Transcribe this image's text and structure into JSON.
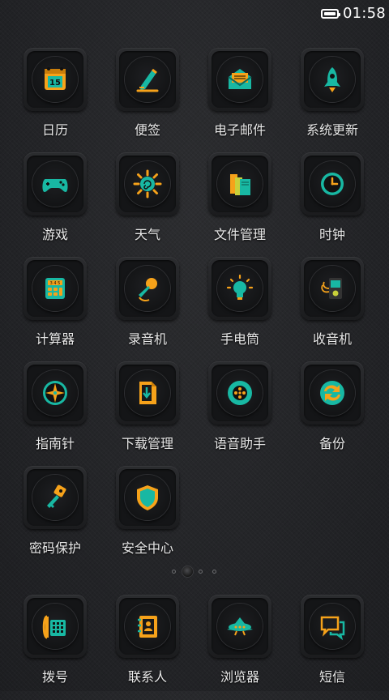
{
  "status_bar": {
    "time": "01:58"
  },
  "colors": {
    "orange": "#f6a21a",
    "teal": "#18b8a3"
  },
  "apps": [
    {
      "label": "日历",
      "icon": "calendar-icon",
      "icon_text": "15"
    },
    {
      "label": "便签",
      "icon": "notes-pen-icon"
    },
    {
      "label": "电子邮件",
      "icon": "email-envelope-icon"
    },
    {
      "label": "系统更新",
      "icon": "rocket-icon"
    },
    {
      "label": "游戏",
      "icon": "gamepad-icon"
    },
    {
      "label": "天气",
      "icon": "sun-weather-icon"
    },
    {
      "label": "文件管理",
      "icon": "books-folder-icon"
    },
    {
      "label": "时钟",
      "icon": "clock-icon"
    },
    {
      "label": "计算器",
      "icon": "calculator-icon",
      "icon_text": "3 4 5"
    },
    {
      "label": "录音机",
      "icon": "microphone-icon"
    },
    {
      "label": "手电筒",
      "icon": "lightbulb-icon"
    },
    {
      "label": "收音机",
      "icon": "radio-icon"
    },
    {
      "label": "指南针",
      "icon": "compass-icon"
    },
    {
      "label": "下载管理",
      "icon": "download-document-icon"
    },
    {
      "label": "语音助手",
      "icon": "voice-assistant-icon"
    },
    {
      "label": "备份",
      "icon": "sync-arrows-icon"
    },
    {
      "label": "密码保护",
      "icon": "key-icon"
    },
    {
      "label": "安全中心",
      "icon": "shield-icon"
    }
  ],
  "dock": [
    {
      "label": "拨号",
      "icon": "phone-icon"
    },
    {
      "label": "联系人",
      "icon": "contacts-book-icon"
    },
    {
      "label": "浏览器",
      "icon": "airplane-browser-icon"
    },
    {
      "label": "短信",
      "icon": "message-bubbles-icon"
    }
  ],
  "pager": {
    "pages": 4,
    "current": 2
  }
}
